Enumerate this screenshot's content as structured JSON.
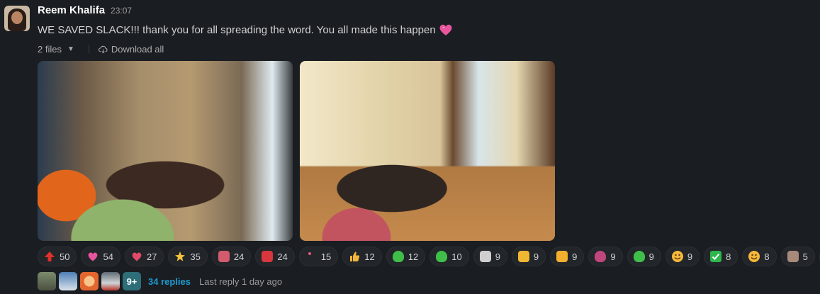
{
  "message": {
    "author": "Reem Khalifa",
    "time": "23:07",
    "text": "WE SAVED SLACK!!! thank you for all spreading the word. You all made this happen",
    "text_emoji": "heart-sparkle-icon"
  },
  "files": {
    "count_label": "2 files",
    "download_label": "Download all"
  },
  "reactions": [
    {
      "icon": "red-arrow-up",
      "count": "50",
      "color": "#e0302a"
    },
    {
      "icon": "sparkling-heart",
      "count": "54",
      "color": "#e8559e"
    },
    {
      "icon": "heart-hands",
      "count": "27",
      "color": "#e24a6a"
    },
    {
      "icon": "star",
      "count": "35",
      "color": "#f5c33b"
    },
    {
      "icon": "custom-pink",
      "count": "24",
      "color": "#d35b6e"
    },
    {
      "icon": "custom-mushroom",
      "count": "24",
      "color": "#d9363e"
    },
    {
      "icon": "custom-dot",
      "count": "15",
      "color": "#e05a7a"
    },
    {
      "icon": "thumbs-up",
      "count": "12",
      "color": "#f3b53a"
    },
    {
      "icon": "custom-green-blob",
      "count": "12",
      "color": "#3fbf4a"
    },
    {
      "icon": "custom-green-blob-2",
      "count": "10",
      "color": "#3fbf4a"
    },
    {
      "icon": "custom-clapper",
      "count": "9",
      "color": "#cfcfcf"
    },
    {
      "icon": "custom-yellow",
      "count": "9",
      "color": "#f0b733"
    },
    {
      "icon": "custom-duck",
      "count": "9",
      "color": "#f3b02e"
    },
    {
      "icon": "custom-purple-blob",
      "count": "9",
      "color": "#c0477d"
    },
    {
      "icon": "custom-green-blob-3",
      "count": "9",
      "color": "#3fbf4a"
    },
    {
      "icon": "grinning-face",
      "count": "9",
      "color": "#f5b83b"
    },
    {
      "icon": "check-mark",
      "count": "8",
      "color": "#2eb64d"
    },
    {
      "icon": "smiley-face",
      "count": "8",
      "color": "#f5b83b"
    },
    {
      "icon": "custom-photo",
      "count": "5",
      "color": "#a88a7a"
    }
  ],
  "thread": {
    "more_label": "9+",
    "replies_label": "34 replies",
    "last_reply_label": "Last reply 1 day ago"
  }
}
